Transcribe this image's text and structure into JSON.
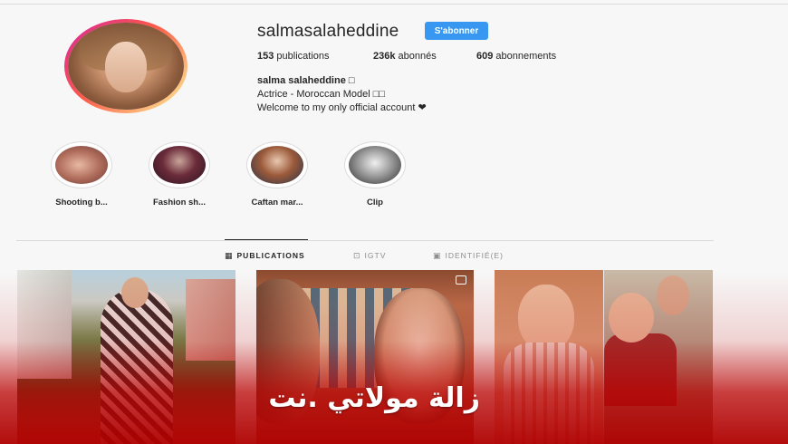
{
  "profile": {
    "username": "salmasalaheddine",
    "follow_label": "S'abonner",
    "stats": {
      "posts_count": "153",
      "posts_label": "publications",
      "followers_count": "236k",
      "followers_label": "abonnés",
      "following_count": "609",
      "following_label": "abonnements"
    },
    "bio": {
      "name": "salma salaheddine □",
      "line1": "Actrice - Moroccan Model □□",
      "line2": "Welcome to my only official account ❤"
    }
  },
  "highlights": [
    {
      "label": "Shooting b..."
    },
    {
      "label": "Fashion sh..."
    },
    {
      "label": "Caftan mar..."
    },
    {
      "label": "Clip"
    }
  ],
  "tabs": [
    {
      "label": "PUBLICATIONS",
      "icon": "grid-icon",
      "glyph": "▦",
      "active": true
    },
    {
      "label": "IGTV",
      "icon": "igtv-icon",
      "glyph": "⊡",
      "active": false
    },
    {
      "label": "IDENTIFIÉ(E)",
      "icon": "tag-icon",
      "glyph": "▣",
      "active": false
    }
  ],
  "watermark": "زالة مولاتي .نت",
  "colors": {
    "follow_button": "#3897f0",
    "overlay_red": "#b00000",
    "avatar_ring": [
      "#d6249f",
      "#fd5949",
      "#fdf497"
    ]
  }
}
